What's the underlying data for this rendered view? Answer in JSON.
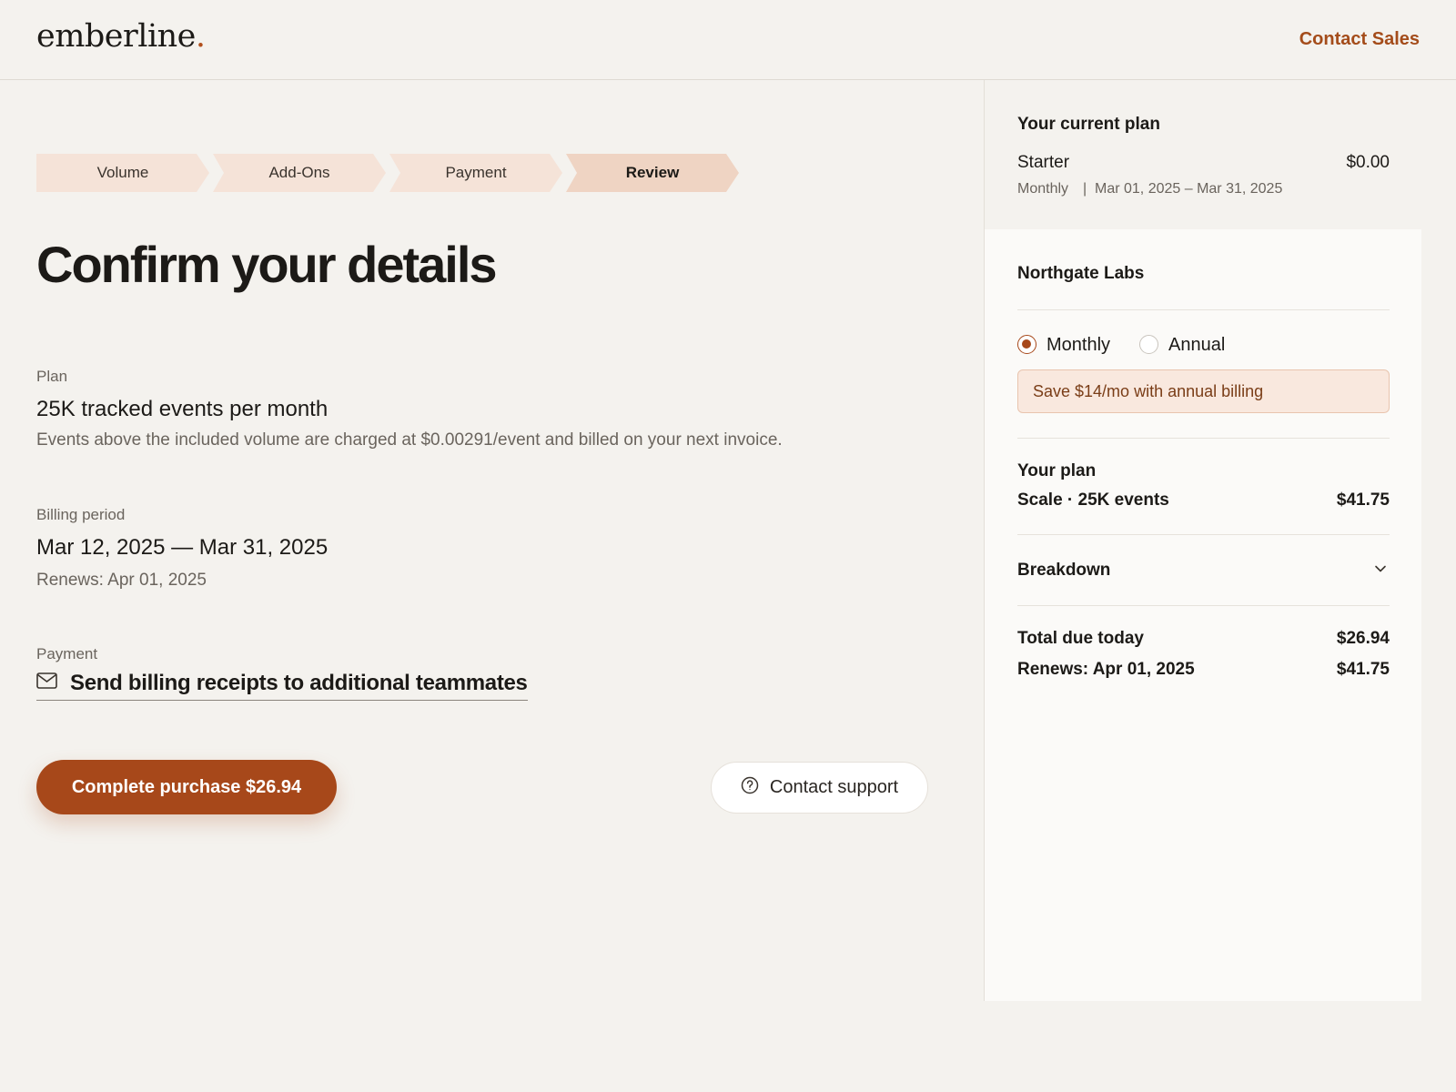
{
  "brand": {
    "name": "emberline",
    "dot": ".",
    "accent": "#b1501c"
  },
  "header": {
    "contact_sales": "Contact Sales"
  },
  "stepper": {
    "steps": [
      "Volume",
      "Add-Ons",
      "Payment",
      "Review"
    ],
    "active": "Review"
  },
  "main": {
    "title": "Confirm your details",
    "plan": {
      "label": "Plan",
      "value": "25K tracked events per month",
      "note": "Events above the included volume are charged at $0.00291/event and billed on your next invoice."
    },
    "billing": {
      "label": "Billing period",
      "value": "Mar 12, 2025 — Mar 31, 2025",
      "note": "Renews: Apr 01, 2025"
    },
    "payment": {
      "label": "Payment",
      "link": "Send billing receipts to additional teammates"
    },
    "cta": "Complete purchase $26.94",
    "support": "Contact support"
  },
  "sidebar": {
    "current": {
      "heading": "Your current plan",
      "plan_name": "Starter",
      "price": "$0.00",
      "cycle": "Monthly",
      "separator": "|",
      "dates": "Mar 01, 2025 – Mar 31, 2025"
    },
    "summary": {
      "org": "Northgate Labs",
      "billing_options": [
        {
          "label": "Monthly",
          "checked": true
        },
        {
          "label": "Annual",
          "checked": false
        }
      ],
      "save_banner": "Save $14/mo with annual billing",
      "your_plan_label": "Your plan",
      "plan_line": "Scale · 25K events",
      "plan_price": "$41.75",
      "breakdown": "Breakdown",
      "total_label": "Total due today",
      "total_value": "$26.94",
      "renews_label": "Renews: Apr 01, 2025",
      "renews_value": "$41.75"
    }
  },
  "colors": {
    "accent": "#a7481a",
    "page_bg": "#f4f2ee",
    "step_bg": "#f5e3d8",
    "step_active_bg": "#efd4c3",
    "banner_bg": "#f9e8de"
  },
  "icons": {
    "email": "mail-icon",
    "support": "help-circle-icon",
    "breakdown": "chevron-down-icon"
  }
}
